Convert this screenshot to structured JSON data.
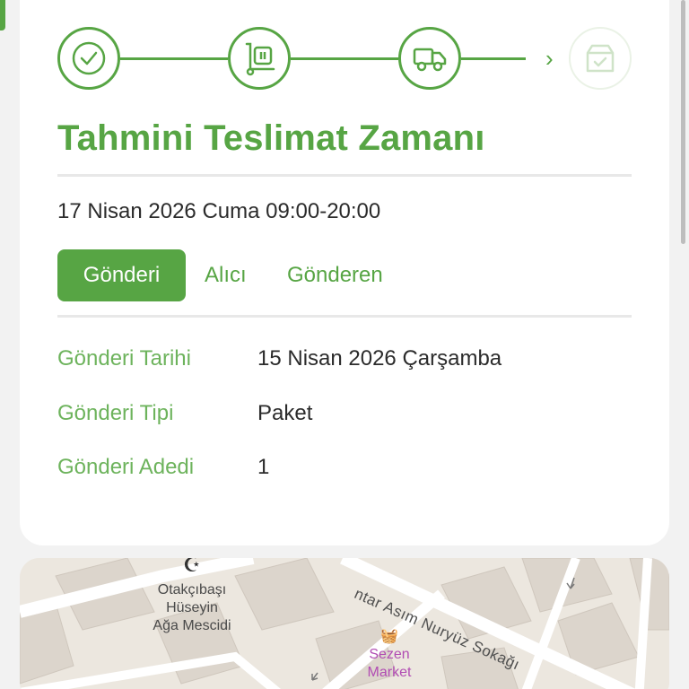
{
  "stepper": {
    "steps": [
      {
        "name": "order-confirmed",
        "icon": "check-circle-icon",
        "state": "done"
      },
      {
        "name": "package-handling",
        "icon": "hand-truck-icon",
        "state": "done"
      },
      {
        "name": "in-transit",
        "icon": "truck-icon",
        "state": "done"
      },
      {
        "name": "delivered",
        "icon": "box-check-icon",
        "state": "pending"
      }
    ],
    "accent_color": "#57a544"
  },
  "delivery": {
    "title": "Tahmini Teslimat Zamanı",
    "estimate": "17 Nisan 2026 Cuma 09:00-20:00"
  },
  "tabs": [
    {
      "label": "Gönderi",
      "active": true
    },
    {
      "label": "Alıcı",
      "active": false
    },
    {
      "label": "Gönderen",
      "active": false
    }
  ],
  "details": [
    {
      "label": "Gönderi Tarihi",
      "value": "15 Nisan 2026 Çarşamba"
    },
    {
      "label": "Gönderi Tipi",
      "value": "Paket"
    },
    {
      "label": "Gönderi Adedi",
      "value": "1"
    }
  ],
  "map": {
    "poi_mosque": "Otakçıbaşı\nHüseyin\nAğa Mescidi",
    "street": "Mimar Asım Nuryüz Sokağı",
    "street_visible": "ntar Asım Nuryüz Sokağı",
    "poi_market": "Sezen\nMarket"
  }
}
